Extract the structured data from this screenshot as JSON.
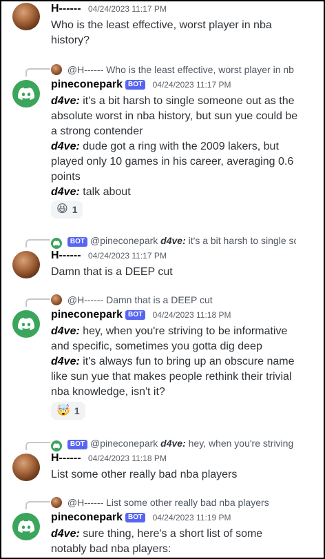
{
  "messages": [
    {
      "author": "H------",
      "timestamp": "04/24/2023 11:17 PM",
      "lines": [
        {
          "text": "Who is the least effective, worst player in nba history?"
        }
      ]
    },
    {
      "reply": {
        "author": "@H------",
        "text": "Who is the least effective, worst player in nb"
      },
      "author": "pineconepark",
      "bot_label": "BOT",
      "timestamp": "04/24/2023 11:17 PM",
      "lines": [
        {
          "nick": "d4ve:",
          "text": "it's a bit harsh to single someone out as the absolute worst in nba history, but sun yue could be a strong contender"
        },
        {
          "nick": "d4ve:",
          "text": "dude got a ring with the 2009 lakers, but played only 10 games in his career, averaging 0.6 points"
        },
        {
          "nick": "d4ve:",
          "text": "talk about"
        }
      ],
      "reaction": {
        "emoji": "😆",
        "count": "1"
      }
    },
    {
      "reply": {
        "bot_label": "BOT",
        "author": "@pineconepark",
        "nick": "d4ve:",
        "text": "it's a bit harsh to single sor"
      },
      "author": "H------",
      "timestamp": "04/24/2023 11:17 PM",
      "lines": [
        {
          "text": "Damn that is a DEEP cut"
        }
      ]
    },
    {
      "reply": {
        "author": "@H------",
        "text": "Damn that is a DEEP cut"
      },
      "author": "pineconepark",
      "bot_label": "BOT",
      "timestamp": "04/24/2023 11:18 PM",
      "lines": [
        {
          "nick": "d4ve:",
          "text": "hey, when you're striving to be informative and specific, sometimes you gotta dig deep"
        },
        {
          "nick": "d4ve:",
          "text": "it's always fun to bring up an obscure name like sun yue that makes people rethink their trivial nba knowledge, isn't it?"
        }
      ],
      "reaction": {
        "emoji": "🤯",
        "count": "1"
      }
    },
    {
      "reply": {
        "bot_label": "BOT",
        "author": "@pineconepark",
        "nick": "d4ve:",
        "text": "hey, when you're striving to"
      },
      "author": "H------",
      "timestamp": "04/24/2023 11:18 PM",
      "lines": [
        {
          "text": "List some other really bad nba players"
        }
      ]
    },
    {
      "reply": {
        "author": "@H------",
        "text": "List some other really bad nba players"
      },
      "author": "pineconepark",
      "bot_label": "BOT",
      "timestamp": "04/24/2023 11:19 PM",
      "lines": [
        {
          "nick": "d4ve:",
          "text": "sure thing, here's a short list of some notably bad nba players:"
        }
      ]
    }
  ],
  "colors": {
    "bot_tag": "#5865f2",
    "bot_avatar": "#3ba55c",
    "reaction_bg": "#f2f3f5",
    "reply_spine": "#c4c9ce"
  },
  "icons": {
    "bot_avatar": "discord-logo-icon",
    "human_avatar": "user-photo-avatar"
  }
}
